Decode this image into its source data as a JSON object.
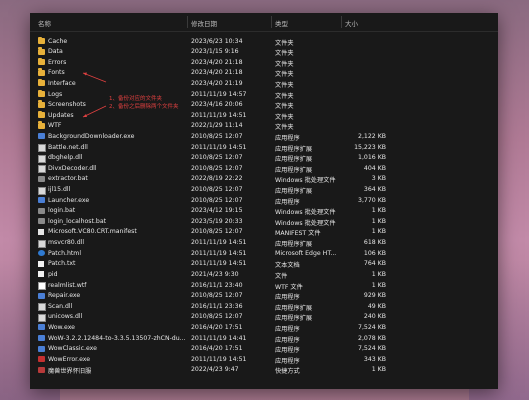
{
  "header": {
    "name": "名称",
    "date": "修改日期",
    "type": "类型",
    "size": "大小"
  },
  "annotations": [
    "1、备份对应的文件夹",
    "2、备份之后删除两个文件夹"
  ],
  "files": [
    {
      "name": "Cache",
      "date": "2023/6/23 10:34",
      "type": "文件夹",
      "size": "",
      "icon": "folder-icon"
    },
    {
      "name": "Data",
      "date": "2023/1/15 9:16",
      "type": "文件夹",
      "size": "",
      "icon": "folder-icon"
    },
    {
      "name": "Errors",
      "date": "2023/4/20 21:18",
      "type": "文件夹",
      "size": "",
      "icon": "folder-icon"
    },
    {
      "name": "Fonts",
      "date": "2023/4/20 21:18",
      "type": "文件夹",
      "size": "",
      "icon": "folder-icon"
    },
    {
      "name": "Interface",
      "date": "2023/4/20 21:19",
      "type": "文件夹",
      "size": "",
      "icon": "folder-icon"
    },
    {
      "name": "Logs",
      "date": "2011/11/19 14:57",
      "type": "文件夹",
      "size": "",
      "icon": "folder-icon"
    },
    {
      "name": "Screenshots",
      "date": "2023/4/16 20:06",
      "type": "文件夹",
      "size": "",
      "icon": "folder-icon"
    },
    {
      "name": "Updates",
      "date": "2011/11/19 14:51",
      "type": "文件夹",
      "size": "",
      "icon": "folder-icon"
    },
    {
      "name": "WTF",
      "date": "2022/1/29 11:14",
      "type": "文件夹",
      "size": "",
      "icon": "folder-icon"
    },
    {
      "name": "BackgroundDownloader.exe",
      "date": "2010/8/25 12:07",
      "type": "应用程序",
      "size": "2,122 KB",
      "icon": "exe-icon"
    },
    {
      "name": "Battle.net.dll",
      "date": "2011/11/19 14:51",
      "type": "应用程序扩展",
      "size": "15,223 KB",
      "icon": "dll-icon"
    },
    {
      "name": "dbghelp.dll",
      "date": "2010/8/25 12:07",
      "type": "应用程序扩展",
      "size": "1,016 KB",
      "icon": "dll-icon"
    },
    {
      "name": "DivxDecoder.dll",
      "date": "2010/8/25 12:07",
      "type": "应用程序扩展",
      "size": "404 KB",
      "icon": "dll-icon"
    },
    {
      "name": "extractor.bat",
      "date": "2022/8/19 22:22",
      "type": "Windows 批处理文件",
      "size": "3 KB",
      "icon": "bat-icon"
    },
    {
      "name": "ijl15.dll",
      "date": "2010/8/25 12:07",
      "type": "应用程序扩展",
      "size": "364 KB",
      "icon": "dll-icon"
    },
    {
      "name": "Launcher.exe",
      "date": "2010/8/25 12:07",
      "type": "应用程序",
      "size": "3,770 KB",
      "icon": "exe-icon"
    },
    {
      "name": "login.bat",
      "date": "2023/4/12 19:15",
      "type": "Windows 批处理文件",
      "size": "1 KB",
      "icon": "bat-icon"
    },
    {
      "name": "login_localhost.bat",
      "date": "2023/5/19 20:33",
      "type": "Windows 批处理文件",
      "size": "1 KB",
      "icon": "bat-icon"
    },
    {
      "name": "Microsoft.VC80.CRT.manifest",
      "date": "2010/8/25 12:07",
      "type": "MANIFEST 文件",
      "size": "1 KB",
      "icon": "manifest-icon"
    },
    {
      "name": "msvcr80.dll",
      "date": "2011/11/19 14:51",
      "type": "应用程序扩展",
      "size": "618 KB",
      "icon": "dll-icon"
    },
    {
      "name": "Patch.html",
      "date": "2011/11/19 14:51",
      "type": "Microsoft Edge HT...",
      "size": "106 KB",
      "icon": "html-icon"
    },
    {
      "name": "Patch.txt",
      "date": "2011/11/19 14:51",
      "type": "文本文档",
      "size": "764 KB",
      "icon": "txt-icon"
    },
    {
      "name": "pid",
      "date": "2021/4/23 9:30",
      "type": "文件",
      "size": "1 KB",
      "icon": "txt-icon"
    },
    {
      "name": "realmlist.wtf",
      "date": "2016/11/1 23:40",
      "type": "WTF 文件",
      "size": "1 KB",
      "icon": "wtf-icon"
    },
    {
      "name": "Repair.exe",
      "date": "2010/8/25 12:07",
      "type": "应用程序",
      "size": "929 KB",
      "icon": "exe-icon"
    },
    {
      "name": "Scan.dll",
      "date": "2016/11/1 23:36",
      "type": "应用程序扩展",
      "size": "49 KB",
      "icon": "dll-icon"
    },
    {
      "name": "unicows.dll",
      "date": "2010/8/25 12:07",
      "type": "应用程序扩展",
      "size": "240 KB",
      "icon": "dll-icon"
    },
    {
      "name": "Wow.exe",
      "date": "2016/4/20 17:51",
      "type": "应用程序",
      "size": "7,524 KB",
      "icon": "exe-icon"
    },
    {
      "name": "WoW-3.2.2.12484-to-3.3.5.13507-zhCN-du...",
      "date": "2011/11/19 14:41",
      "type": "应用程序",
      "size": "2,078 KB",
      "icon": "exe-icon"
    },
    {
      "name": "WowClassic.exe",
      "date": "2016/4/20 17:51",
      "type": "应用程序",
      "size": "7,524 KB",
      "icon": "exe-icon"
    },
    {
      "name": "WowError.exe",
      "date": "2011/11/19 14:51",
      "type": "应用程序",
      "size": "343 KB",
      "icon": "error-icon"
    },
    {
      "name": "魔兽世界怀旧服",
      "date": "2022/4/23 9:47",
      "type": "快捷方式",
      "size": "1 KB",
      "icon": "shortcut-icon"
    }
  ]
}
